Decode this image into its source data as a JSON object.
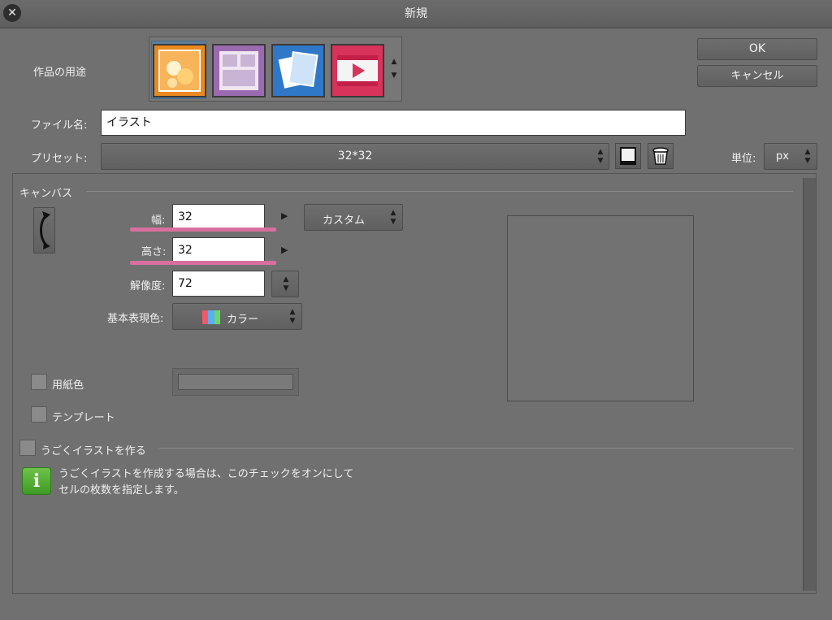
{
  "window": {
    "title": "新規"
  },
  "usage": {
    "label": "作品の用途",
    "icons": [
      "illustration-icon",
      "comic-icon",
      "all-comic-settings-icon",
      "animation-icon"
    ]
  },
  "buttons": {
    "ok": "OK",
    "cancel": "キャンセル"
  },
  "file_name": {
    "label": "ファイル名:",
    "value": "イラスト"
  },
  "preset": {
    "label": "プリセット:",
    "value": "32*32"
  },
  "unit": {
    "label": "単位:",
    "value": "px"
  },
  "canvas": {
    "section_label": "キャンバス",
    "width_label": "幅:",
    "width_value": "32",
    "height_label": "高さ:",
    "height_value": "32",
    "resolution_label": "解像度:",
    "resolution_value": "72",
    "size_preset": "カスタム",
    "color_label": "基本表現色:",
    "color_value": "カラー"
  },
  "paper_color": {
    "label": "用紙色"
  },
  "template": {
    "label": "テンプレート"
  },
  "animation": {
    "label": "うごくイラストを作る"
  },
  "info": {
    "line1": "うごくイラストを作成する場合は、このチェックをオンにして",
    "line2": "セルの枚数を指定します。"
  },
  "colors": {
    "background": "#707070",
    "highlight": "#d86f9c",
    "selected_icon": "#e9891f"
  }
}
